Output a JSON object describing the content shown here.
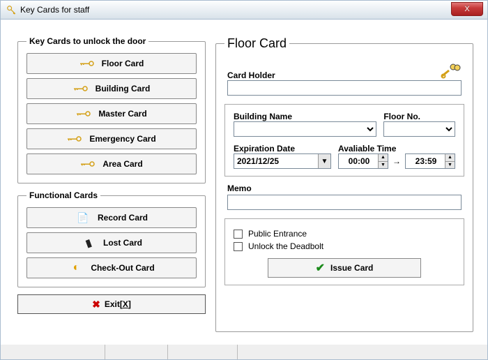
{
  "window": {
    "title": "Key Cards for staff",
    "close": "X"
  },
  "groups": {
    "unlock": "Key Cards to unlock the door",
    "functional": "Functional Cards"
  },
  "unlock_buttons": {
    "floor": "Floor Card",
    "building": "Building Card",
    "master": "Master Card",
    "emergency": "Emergency Card",
    "area": "Area Card"
  },
  "functional_buttons": {
    "record": "Record Card",
    "lost": "Lost Card",
    "checkout": "Check-Out Card"
  },
  "exit": {
    "label": "Exit[",
    "hotkey": "X",
    "suffix": "]"
  },
  "form": {
    "legend": "Floor Card",
    "card_holder_label": "Card Holder",
    "card_holder_value": "",
    "building_name_label": "Building Name",
    "building_name_value": "",
    "floor_no_label": "Floor No.",
    "floor_no_value": "",
    "expiration_label": "Expiration Date",
    "expiration_value": "2021/12/25",
    "available_label": "Avaliable Time",
    "time_from": "00:00",
    "time_to": "23:59",
    "memo_label": "Memo",
    "memo_value": "",
    "public_entrance_label": "Public Entrance",
    "public_entrance_checked": false,
    "unlock_deadbolt_label": "Unlock the Deadbolt",
    "unlock_deadbolt_checked": false,
    "issue_label": "Issue Card"
  }
}
